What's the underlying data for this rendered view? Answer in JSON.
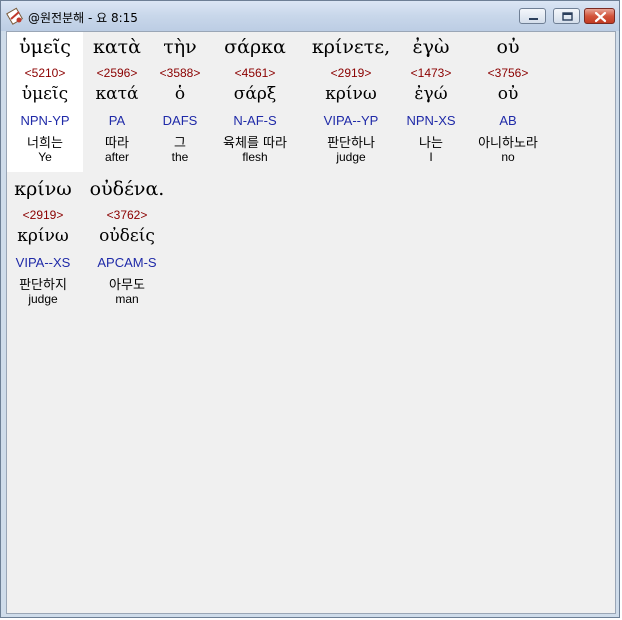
{
  "window": {
    "title": "@원전분해 - 요 8:15"
  },
  "controls": {
    "minimize": "minimize",
    "maximize": "maximize",
    "close": "close"
  },
  "colors": {
    "strong": "#8b0000",
    "morph": "#1f2aa8",
    "titlebar": "#c8d7ea",
    "client_bg": "#f0f0f0"
  },
  "words": [
    {
      "greek": "ὑμεῖς",
      "strong": "<5210>",
      "lemma": "ὑμεῖς",
      "morph": "NPN-YP",
      "korean": "너희는",
      "english": "Ye"
    },
    {
      "greek": "κατὰ",
      "strong": "<2596>",
      "lemma": "κατά",
      "morph": "PA",
      "korean": "따라",
      "english": "after"
    },
    {
      "greek": "τὴν",
      "strong": "<3588>",
      "lemma": "ὁ",
      "morph": "DAFS",
      "korean": "그",
      "english": "the"
    },
    {
      "greek": "σάρκα",
      "strong": "<4561>",
      "lemma": "σάρξ",
      "morph": "N-AF-S",
      "korean": "육체를 따라",
      "english": "flesh"
    },
    {
      "greek": "κρίνετε,",
      "strong": "<2919>",
      "lemma": "κρίνω",
      "morph": "VIPA--YP",
      "korean": "판단하나",
      "english": "judge"
    },
    {
      "greek": "ἐγὼ",
      "strong": "<1473>",
      "lemma": "ἐγώ",
      "morph": "NPN-XS",
      "korean": "나는",
      "english": "I"
    },
    {
      "greek": "οὐ",
      "strong": "<3756>",
      "lemma": "οὐ",
      "morph": "AB",
      "korean": "아니하노라",
      "english": "no"
    },
    {
      "greek": "κρίνω",
      "strong": "<2919>",
      "lemma": "κρίνω",
      "morph": "VIPA--XS",
      "korean": "판단하지",
      "english": "judge"
    },
    {
      "greek": "οὐδένα.",
      "strong": "<3762>",
      "lemma": "οὐδείς",
      "morph": "APCAM-S",
      "korean": "아무도",
      "english": "man"
    }
  ]
}
